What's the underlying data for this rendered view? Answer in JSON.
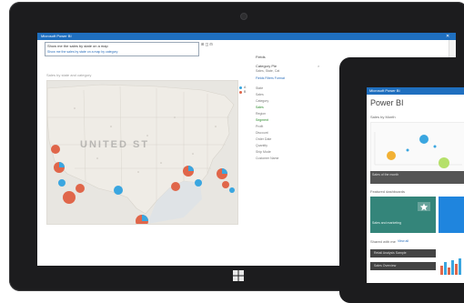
{
  "main_app": {
    "window_title": "Microsoft Power BI",
    "query_text": "Show me the sales by state on a map",
    "query_link": "Show me the sales by state on a map by category",
    "toolbar_icons": "⊞ ◫  ⊟",
    "close_glyph": "✕",
    "map_title": "Sales by state and category",
    "map_caption": "UNITED ST",
    "legend": [
      {
        "label": "A",
        "color": "#3aa6e0"
      },
      {
        "label": "B",
        "color": "#e0664a"
      }
    ],
    "fields": {
      "title": "Fields",
      "header": "Category Pie",
      "sub": "Sales, State, Cat",
      "tabs": "Fields  Filters  Format",
      "list": [
        "State",
        "Sales",
        "Category",
        "Sales",
        "Region",
        "Segment",
        "Profit",
        "Discount",
        "Order Date",
        "Quantity",
        "Ship Mode",
        "Customer Name"
      ],
      "close_glyph": "×"
    }
  },
  "second_app": {
    "window_title": "Microsoft Power BI",
    "app_title": "Power BI",
    "section_1": "Sales by Month",
    "chart_caption": "Sales of the month",
    "section_2": "Featured dashboards",
    "tile_text": "Sales and marketing",
    "section_3": "Shared with me",
    "section_3_tag": "View all",
    "rows": [
      "Retail Analysis Sample",
      "Sales Overview"
    ]
  },
  "colors": {
    "brand_blue": "#1f6fbf",
    "bubble_blue": "#3aa6e0",
    "bubble_orange": "#e0664a",
    "tile_green": "#34857a",
    "tile_blue": "#1f85de"
  },
  "icons": {
    "windows_logo": "windows-logo-icon",
    "star": "star-icon"
  }
}
